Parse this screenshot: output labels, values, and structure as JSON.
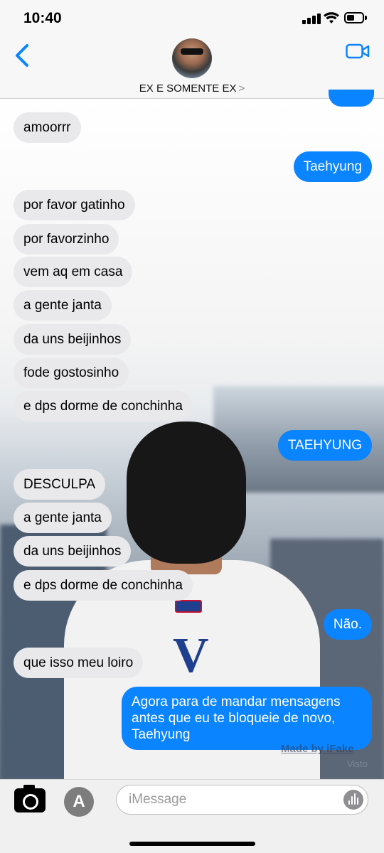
{
  "status_bar": {
    "time": "10:40"
  },
  "header": {
    "contact_name": "EX E SOMENTE EX",
    "chevron": ">"
  },
  "messages": [
    {
      "from": "them",
      "text": "amoorrr"
    },
    {
      "from": "me",
      "text": "Taehyung"
    },
    {
      "from": "them",
      "text": "por favor gatinho"
    },
    {
      "from": "them",
      "text": "por favorzinho"
    },
    {
      "from": "them",
      "text": "vem aq em casa"
    },
    {
      "from": "them",
      "text": "a gente janta"
    },
    {
      "from": "them",
      "text": "da uns beijinhos"
    },
    {
      "from": "them",
      "text": "fode gostosinho"
    },
    {
      "from": "them",
      "text": "e dps dorme de conchinha"
    },
    {
      "from": "me",
      "text": "TAEHYUNG"
    },
    {
      "from": "them",
      "text": "DESCULPA"
    },
    {
      "from": "them",
      "text": "a gente janta"
    },
    {
      "from": "them",
      "text": "da uns beijinhos"
    },
    {
      "from": "them",
      "text": "e dps dorme de conchinha"
    },
    {
      "from": "me",
      "text": "Não."
    },
    {
      "from": "them",
      "text": "que isso meu loiro"
    },
    {
      "from": "me",
      "text": "Agora para de mandar mensagens antes que eu te bloqueie de novo, Taehyung",
      "lines": [
        "Agora para de mandar mensagens",
        "antes que eu te bloqueie de novo,",
        "Taehyung"
      ]
    }
  ],
  "watermark": "Made by iFake",
  "read_receipt": "Visto",
  "composer": {
    "placeholder": "iMessage"
  },
  "icons": [
    "back-chevron-icon",
    "video-camera-icon",
    "camera-icon",
    "app-store-icon",
    "audio-waveform-icon",
    "wifi-icon",
    "cellular-signal-icon",
    "battery-icon"
  ],
  "colors": {
    "outgoing_bubble": "#0b84ff",
    "incoming_bubble": "#e9e9eb",
    "accent": "#0b84ff"
  },
  "battery_level": 0.5
}
